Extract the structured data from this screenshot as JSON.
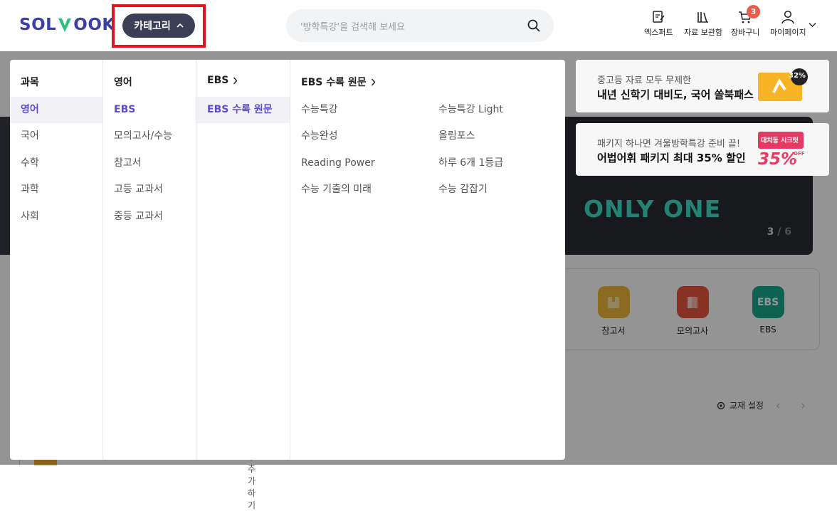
{
  "header": {
    "logo_a": "SOL",
    "logo_b": "OOK",
    "category_button": "카테고리",
    "search_placeholder": "'방학특강'을 검색해 보세요",
    "icons": [
      {
        "label": "엑스퍼트",
        "icon": "edit-icon"
      },
      {
        "label": "자료 보관함",
        "icon": "library-icon"
      },
      {
        "label": "장바구니",
        "icon": "cart-icon",
        "badge": "3"
      },
      {
        "label": "마이페이지",
        "icon": "user-icon"
      }
    ]
  },
  "background": {
    "banner_text": "ONLY ONE",
    "banner_page_current": "3",
    "banner_page_total": "/ 6",
    "categories": [
      {
        "label": "참고서",
        "color": "#f0b93a"
      },
      {
        "label": "모의고사",
        "color": "#e9573f"
      },
      {
        "label": "EBS",
        "color": "#19a98c",
        "icon_text": "EBS"
      }
    ],
    "settings_label": "교재 설정",
    "stub_text": "+ 추가하기"
  },
  "ads": [
    {
      "line1": "중고등 자료 모두 무제한",
      "line2": "내년 신학기 대비도, 국어 쏠북패스",
      "badge": "32%"
    },
    {
      "line1": "패키지 하나면 겨울방학특강 준비 끝!",
      "line2": "어법어휘 패키지 최대 35% 할인",
      "badge_top": "대치동 시크릿",
      "badge": "35%",
      "badge_off": "OFF"
    }
  ],
  "menu": {
    "subjects": {
      "header": "과목",
      "items": [
        "영어",
        "국어",
        "수학",
        "과학",
        "사회"
      ],
      "selected": 0
    },
    "types": {
      "header": "영어",
      "items": [
        "EBS",
        "모의고사/수능",
        "참고서",
        "고등 교과서",
        "중등 교과서"
      ],
      "active": 0
    },
    "ebs": {
      "header": "EBS",
      "items": [
        "EBS 수록 원문"
      ],
      "selected": 0
    },
    "books": {
      "header": "EBS 수록 원문",
      "left": [
        "수능특강",
        "수능완성",
        "Reading Power",
        "수능 기출의 미래"
      ],
      "right": [
        "수능특강 Light",
        "올림포스",
        "하루 6개 1등급",
        "수능 감잡기"
      ]
    }
  },
  "colors": {
    "accent": "#5b4fd0",
    "brand": "#3b3fa8",
    "highlight_box": "#e0161b"
  }
}
